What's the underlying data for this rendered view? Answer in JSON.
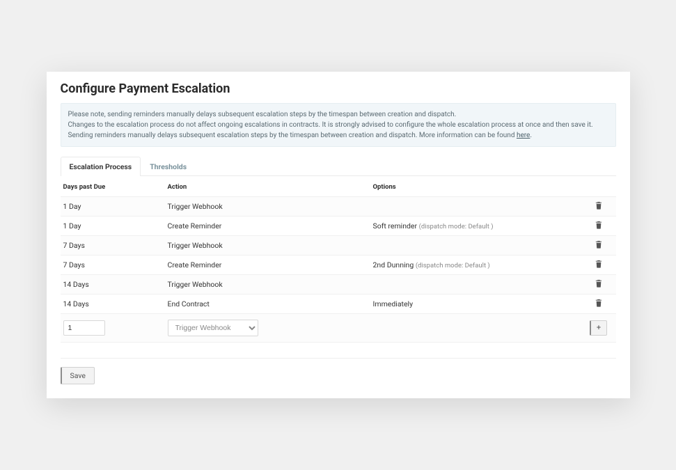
{
  "title": "Configure Payment Escalation",
  "info": {
    "text1": "Please note, sending reminders manually delays subsequent escalation steps by the timespan between creation and dispatch.",
    "text2_a": "Changes to the escalation process do not affect ongoing escalations in contracts. It is strongly advised to configure the whole escalation process at once and then save it. Sending reminders manually delays subsequent escalation steps by the timespan between creation and dispatch. More information can be found ",
    "link": "here",
    "text2_b": "."
  },
  "tabs": {
    "active": "Escalation Process",
    "inactive": "Thresholds"
  },
  "columns": {
    "days": "Days past Due",
    "action": "Action",
    "options": "Options"
  },
  "rows": [
    {
      "days": "1 Day",
      "action": "Trigger Webhook",
      "option": "",
      "dispatch": ""
    },
    {
      "days": "1 Day",
      "action": "Create Reminder",
      "option": "Soft reminder ",
      "dispatch": "(dispatch mode: Default )"
    },
    {
      "days": "7 Days",
      "action": "Trigger Webhook",
      "option": "",
      "dispatch": ""
    },
    {
      "days": "7 Days",
      "action": "Create Reminder",
      "option": "2nd Dunning ",
      "dispatch": "(dispatch mode: Default )"
    },
    {
      "days": "14 Days",
      "action": "Trigger Webhook",
      "option": "",
      "dispatch": ""
    },
    {
      "days": "14 Days",
      "action": "End Contract",
      "option": "Immediately",
      "dispatch": ""
    }
  ],
  "input": {
    "days_value": "1",
    "action_placeholder": "Trigger Webhook",
    "add_label": "+"
  },
  "save_label": "Save"
}
